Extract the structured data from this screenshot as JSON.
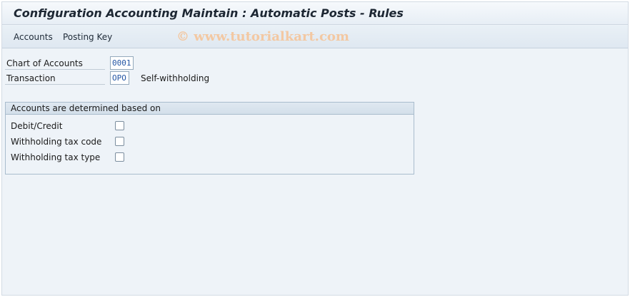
{
  "window": {
    "title": "Configuration Accounting Maintain : Automatic Posts - Rules"
  },
  "menu": {
    "items": [
      {
        "label": "Accounts"
      },
      {
        "label": "Posting Key"
      }
    ]
  },
  "watermark": "© www.tutorialkart.com",
  "fields": {
    "chart_of_accounts": {
      "label": "Chart of Accounts",
      "value": "0001"
    },
    "transaction": {
      "label": "Transaction",
      "value": "OPO",
      "description": "Self-withholding"
    }
  },
  "group": {
    "title": "Accounts are determined based on",
    "options": [
      {
        "label": "Debit/Credit",
        "checked": false
      },
      {
        "label": "Withholding tax code",
        "checked": false
      },
      {
        "label": "Withholding tax type",
        "checked": false
      }
    ]
  }
}
